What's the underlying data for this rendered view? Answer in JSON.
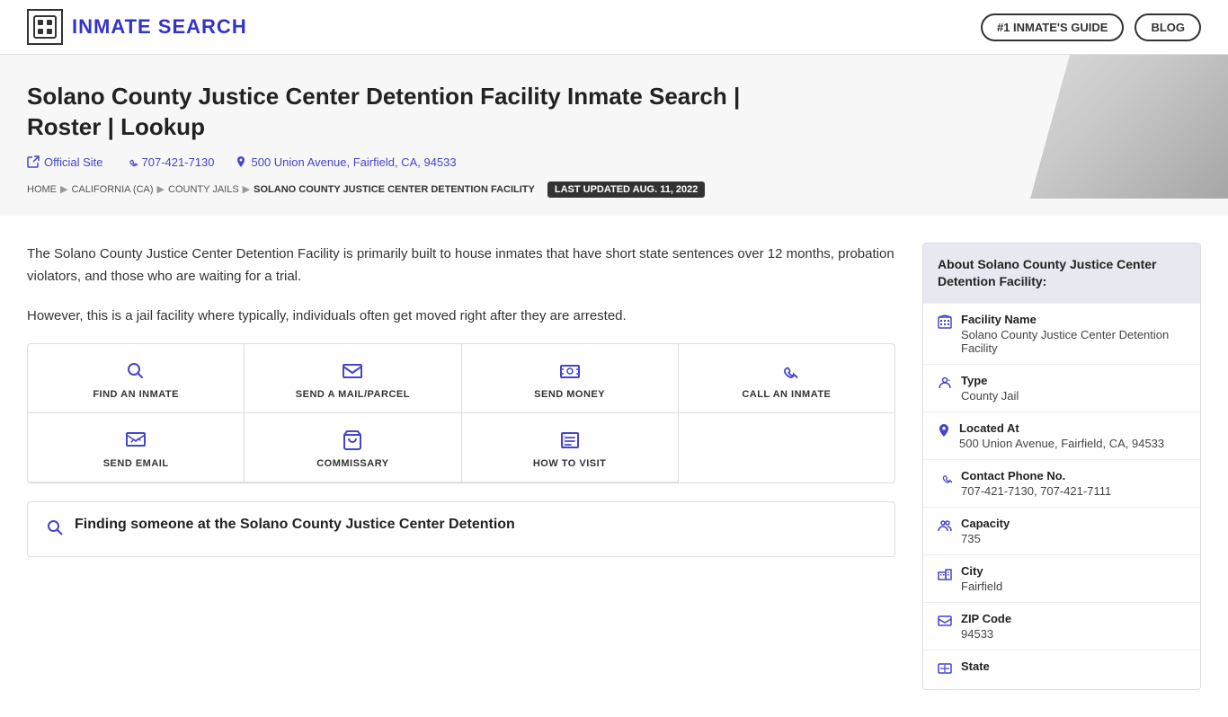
{
  "header": {
    "logo_text": "INMATE SEARCH",
    "nav_guide_label": "#1 INMATE'S GUIDE",
    "nav_blog_label": "BLOG"
  },
  "hero": {
    "title": "Solano County Justice Center Detention Facility Inmate Search | Roster | Lookup",
    "official_site_label": "Official Site",
    "phone": "707-421-7130",
    "address": "500 Union Avenue, Fairfield, CA, 94533",
    "last_updated": "LAST UPDATED AUG. 11, 2022",
    "breadcrumb": {
      "home": "HOME",
      "state": "CALIFORNIA (CA)",
      "county": "COUNTY JAILS",
      "facility": "SOLANO COUNTY JUSTICE CENTER DETENTION FACILITY"
    }
  },
  "description": {
    "para1": "The Solano County Justice Center Detention Facility is primarily built to house inmates that have short state sentences over 12 months, probation violators, and those who are waiting for a trial.",
    "para2": "However, this is a jail facility where typically, individuals often get moved right after they are arrested."
  },
  "actions": {
    "row1": [
      {
        "id": "find-inmate",
        "label": "FIND AN INMATE",
        "icon": "search"
      },
      {
        "id": "send-mail",
        "label": "SEND A MAIL/PARCEL",
        "icon": "mail"
      },
      {
        "id": "send-money",
        "label": "SEND MONEY",
        "icon": "money"
      },
      {
        "id": "call-inmate",
        "label": "CALL AN INMATE",
        "icon": "phone"
      }
    ],
    "row2": [
      {
        "id": "send-email",
        "label": "SEND EMAIL",
        "icon": "email"
      },
      {
        "id": "commissary",
        "label": "COMMISSARY",
        "icon": "cart"
      },
      {
        "id": "how-to-visit",
        "label": "HOW TO VISIT",
        "icon": "list"
      }
    ]
  },
  "finding_section": {
    "heading": "Finding someone at the Solano County Justice Center Detention"
  },
  "about": {
    "header": "About Solano County Justice Center Detention Facility:",
    "items": [
      {
        "label": "Facility Name",
        "value": "Solano County Justice Center Detention Facility",
        "icon": "building"
      },
      {
        "label": "Type",
        "value": "County Jail",
        "icon": "type"
      },
      {
        "label": "Located At",
        "value": "500 Union Avenue, Fairfield, CA, 94533",
        "icon": "pin"
      },
      {
        "label": "Contact Phone No.",
        "value": "707-421-7130, 707-421-7111",
        "icon": "phone"
      },
      {
        "label": "Capacity",
        "value": "735",
        "icon": "people"
      },
      {
        "label": "City",
        "value": "Fairfield",
        "icon": "building2"
      },
      {
        "label": "ZIP Code",
        "value": "94533",
        "icon": "mail"
      },
      {
        "label": "State",
        "value": "",
        "icon": "state"
      }
    ]
  }
}
